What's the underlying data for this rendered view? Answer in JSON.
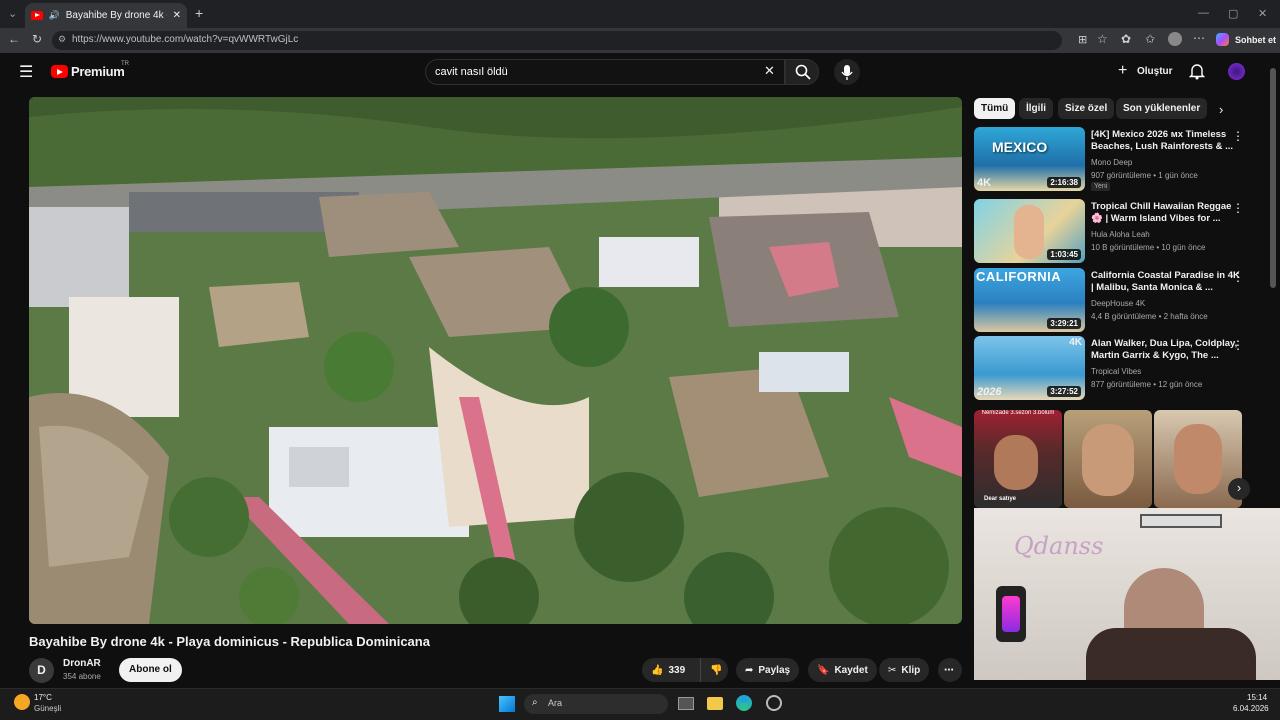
{
  "browser": {
    "tab_title": "Bayahibe By drone 4k - Playa",
    "url": "https://www.youtube.com/watch?v=qvWWRTwGjLc",
    "copilot": "Sohbet et"
  },
  "header": {
    "logo": "Premium",
    "region": "TR",
    "search_value": "cavit nasıl öldü",
    "create_label": "Oluştur"
  },
  "video": {
    "title": "Bayahibe By drone 4k - Playa dominicus - Republica Dominicana",
    "channel": "DronAR",
    "channel_initial": "D",
    "subscribers": "354 abone",
    "subscribe_label": "Abone ol",
    "likes": "339",
    "share": "Paylaş",
    "save": "Kaydet",
    "clip": "Klip"
  },
  "chips": [
    "Tümü",
    "İlgili",
    "Size özel",
    "Son yüklenenler"
  ],
  "recommendations": [
    {
      "title": "[4K] Mexico 2026 ᴍx Timeless Beaches, Lush Rainforests & ...",
      "channel": "Mono Deep",
      "meta": "907 görüntüleme • 1 gün önce",
      "badge": "Yeni",
      "duration": "2:16:38",
      "thumb_text": "MEXICO",
      "corner": "4K"
    },
    {
      "title": "Tropical Chill Hawaiian Reggae 🌸 | Warm Island Vibes for ...",
      "channel": "Hula Aloha Leah",
      "meta": "10 B görüntüleme • 10 gün önce",
      "duration": "1:03:45"
    },
    {
      "title": "California Coastal Paradise in 4K | Malibu, Santa Monica & ...",
      "channel": "DeepHouse 4K",
      "meta": "4,4 B görüntüleme • 2 hafta önce",
      "duration": "3:29:21",
      "thumb_text": "CALIFORNIA"
    },
    {
      "title": "Alan Walker, Dua Lipa, Coldplay, Martin Garrix & Kygo, The ...",
      "channel": "Tropical Vibes",
      "meta": "877 görüntüleme • 12 gün önce",
      "duration": "3:27:52",
      "thumb_text": "2026",
      "corner": "4K"
    }
  ],
  "shorts": {
    "caption1": "Nemizade 3.sezon 3.bölüm",
    "caption2": "Dear satıye"
  },
  "webcam": {
    "neon": "Qdanss"
  },
  "taskbar": {
    "temp": "17°C",
    "weather": "Güneşli",
    "search": "Ara",
    "time": "15:14",
    "date": "6.04.2026"
  },
  "colors": {
    "brand": "#ff0000",
    "bg": "#0f0f0f",
    "chip": "#272727"
  }
}
